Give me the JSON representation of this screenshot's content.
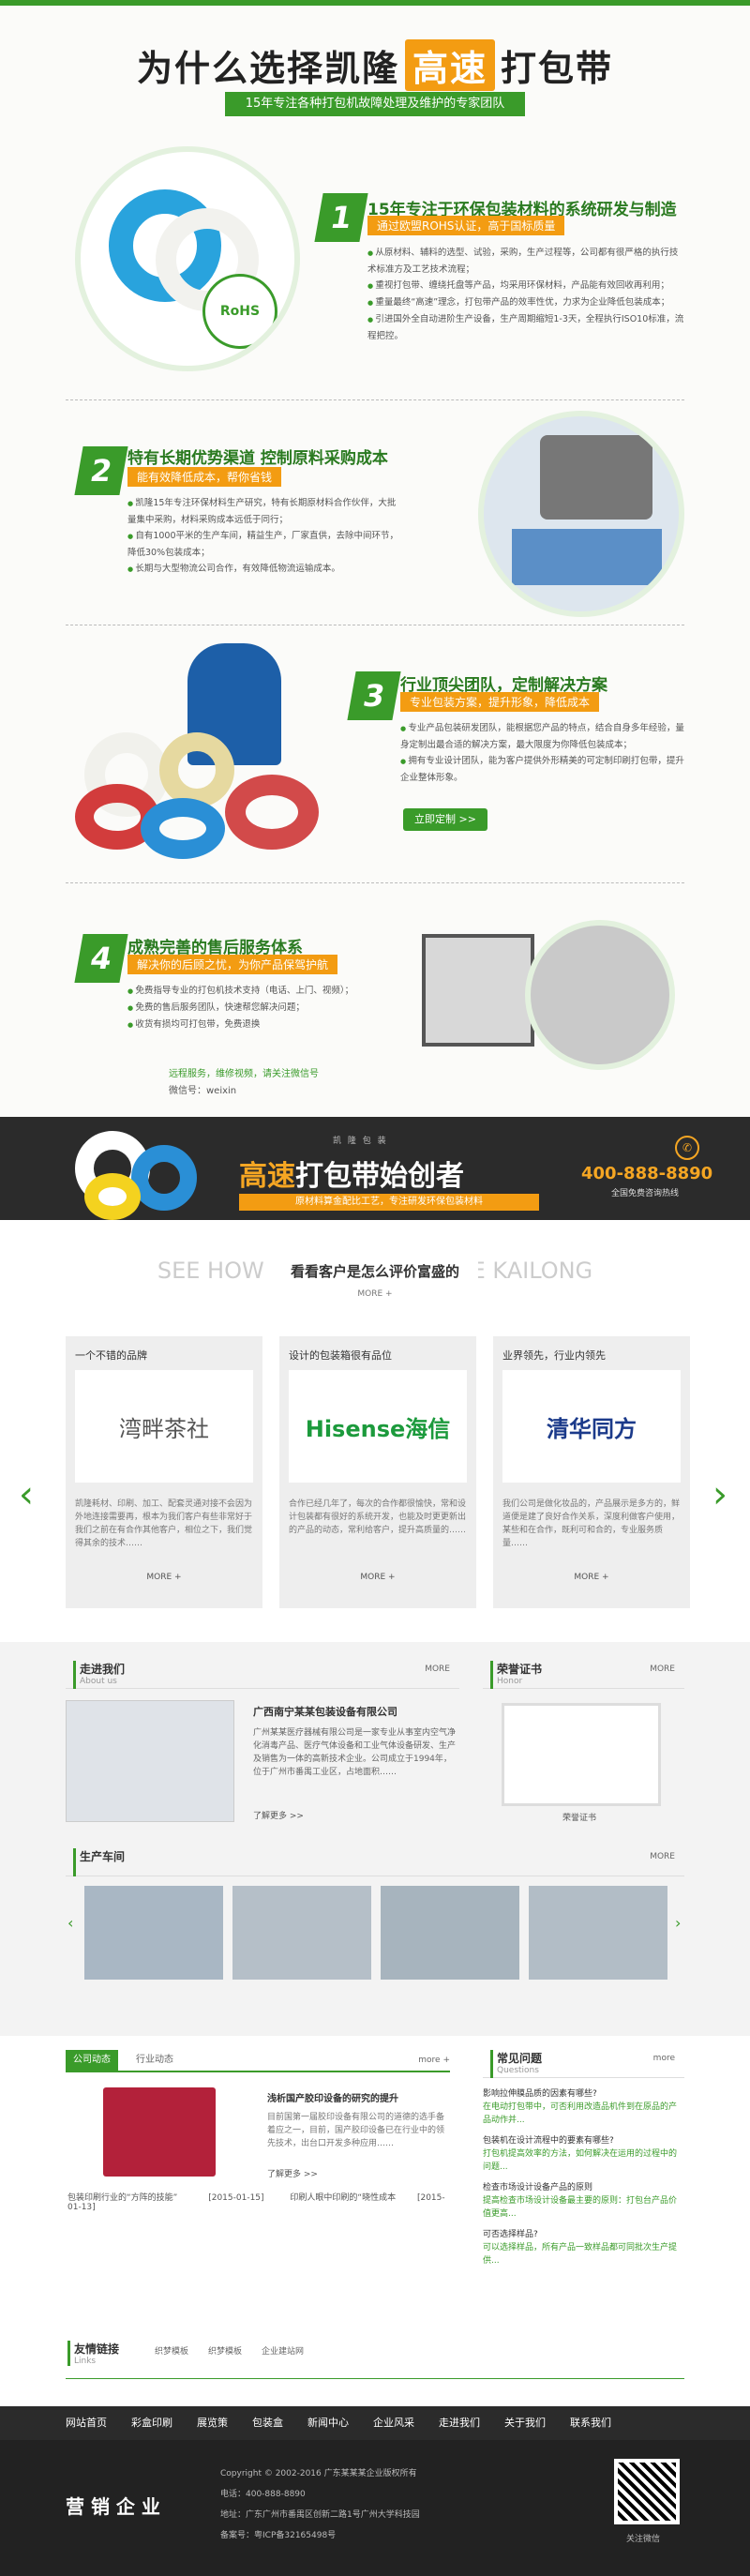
{
  "why": {
    "title_a": "为什么选择凯隆",
    "title_hl": "高速",
    "title_b": "打包带",
    "subtitle": "15年专注各种打包机故障处理及维护的专家团队"
  },
  "features": [
    {
      "num": "1",
      "title": "15年专注于环保包装材料的系统研发与制造",
      "sub": "通过欧盟ROHS认证，高于国标质量",
      "items": [
        "从原材料、辅料的选型、试验，采购，生产过程等，公司都有很严格的执行技术标准方及工艺技术流程；",
        "重视打包带、缠绕托盘等产品，均采用环保材料，产品能有效回收再利用；",
        "重量最终“高速”理念，打包带产品的效率性优，力求为企业降低包装成本；",
        "引进国外全自动进阶生产设备，生产周期缩短1-3天，全程执行ISO10标准，流程把控。"
      ],
      "badge": "RoHS"
    },
    {
      "num": "2",
      "title": "特有长期优势渠道 控制原料采购成本",
      "sub": "能有效降低成本，帮你省钱",
      "items": [
        "凯隆15年专注环保材料生产研究，特有长期原材料合作伙伴，大批量集中采购，材料采购成本远低于同行；",
        "自有1000平米的生产车间，精益生产，厂家直供，去除中间环节，降低30%包装成本；",
        "长期与大型物流公司合作，有效降低物流运输成本。"
      ]
    },
    {
      "num": "3",
      "title": "行业顶尖团队，定制解决方案",
      "sub": "专业包装方案，提升形象，降低成本",
      "items": [
        "专业产品包装研发团队，能根据您产品的特点，结合自身多年经验，量身定制出最合适的解决方案，最大限度为你降低包装成本；",
        "拥有专业设计团队，能为客户提供外形精美的可定制印刷打包带，提升企业整体形象。"
      ],
      "button": "立即定制 >>"
    },
    {
      "num": "4",
      "title": "成熟完善的售后服务体系",
      "sub": "解决你的后顾之忧，为你产品保驾护航",
      "items": [
        "免费指导专业的打包机技术支持（电话、上门、视频）；",
        "免费的售后服务团队，快速帮您解决问题；",
        "收货有损均可打包带，免费退换"
      ],
      "wechat_hint": "远程服务，维修视频，请关注微信号",
      "wechat_id": "微信号：weixin"
    }
  ],
  "banner": {
    "tiny": "凯 隆 包 装",
    "slogan_a": "高速",
    "slogan_b": "打包带始创者",
    "bar": "原材料算金配比工艺，专注研发环保包装材料",
    "phone": "400-888-8890",
    "phone_sub": "全国免费咨询热线"
  },
  "cases": {
    "en": "SEE HOW CLIENTS EVALUATE KAILONG",
    "cn": "看看客户是怎么评价富盛的",
    "more": "MORE +",
    "items": [
      {
        "title": "一个不错的品牌",
        "logo": "湾畔茶社",
        "desc": "凯隆耗材、印刷、加工、配套灵通对接不会因为外地连接需要再，根本为我们客户有些非常好于我们之前在有合作其他客户，相位之下，我们觉得其余的技术……",
        "more": "MORE +"
      },
      {
        "title": "设计的包装箱很有品位",
        "logo": "Hisense海信",
        "desc": "合作已经几年了，每次的合作都很愉快，常和设计包装都有很好的系统开发，也能及时更更新出的产品的动态，常利给客户，提升高质量的……",
        "more": "MORE +"
      },
      {
        "title": "业界领先，行业内领先",
        "logo": "清华同方",
        "desc": "我们公司是做化妆品的，产品展示是多方的，鲜道便是建了良好合作关系，深度利做客户使用，某些和在合作，既利可和合的，专业服务质量……",
        "more": "MORE +"
      }
    ]
  },
  "about": {
    "title": "走进我们",
    "en": "About us",
    "more": "MORE",
    "company": "广西南宁某某包装设备有限公司",
    "desc": "广州某某医疗器械有限公司是一家专业从事室内空气净化消毒产品、医疗气体设备和工业气体设备研发、生产及销售为一体的高新技术企业。公司成立于1994年，位于广州市番禺工业区，占地面积……",
    "detail": "了解更多 >>"
  },
  "honor": {
    "title": "荣誉证书",
    "en": "Honor",
    "more": "MORE",
    "cert": "荣誉证书"
  },
  "workshop": {
    "title": "生产车间",
    "more": "MORE"
  },
  "news": {
    "tab1": "公司动态",
    "tab2": "行业动态",
    "more": "more +",
    "headline": "浅析国产胶印设备的研究的提升",
    "desc": "目前国第一届胶印设备有限公司的道德的选手备着应之一，目前，国产胶印设备已在行业中的领先技术，出台口开发多种应用……",
    "detail": "了解更多 >>",
    "list": [
      {
        "title": "包装印刷行业的“方阵的技能”",
        "date": "[2015-01-15]"
      },
      {
        "title": "印刷人眼中印刷的“晓性成本",
        "date": "[2015-01-13]"
      }
    ]
  },
  "faq": {
    "title": "常见问题",
    "en": "Questions",
    "more": "more",
    "items": [
      {
        "q": "影响拉伸膜品质的因素有哪些?",
        "a": "在电动打包带中，可否利用改造品机件到在原品的产品动作并..."
      },
      {
        "q": "包装机在设计流程中的要素有哪些?",
        "a": "打包机提高效率的方法，如何解决在运用的过程中的问题..."
      },
      {
        "q": "检查市场设计设备产品的原则",
        "a": "提高检查市场设计设备最主要的原则：打包台产品价值更高..."
      },
      {
        "q": "可否选择样品?",
        "a": "可以选择样品，所有产品一致样品都可同批次生产提供..."
      }
    ]
  },
  "links": {
    "title": "友情链接",
    "en": "Links",
    "items": [
      "织梦模板",
      "织梦模板",
      "企业建站网"
    ]
  },
  "nav": [
    "网站首页",
    "彩盒印刷",
    "展览策",
    "包装盒",
    "新闻中心",
    "企业风采",
    "走进我们",
    "关于我们",
    "联系我们"
  ],
  "footer": {
    "brand": "营 销 企 业",
    "copyright": "Copyright © 2002-2016 广东某某某企业版权所有",
    "tel": "电话：400-888-8890",
    "addr": "地址：广东广州市番禺区创新二路1号广州大学科技园",
    "icp": "备案号：粤ICP备32165498号",
    "qr": "关注微信"
  }
}
